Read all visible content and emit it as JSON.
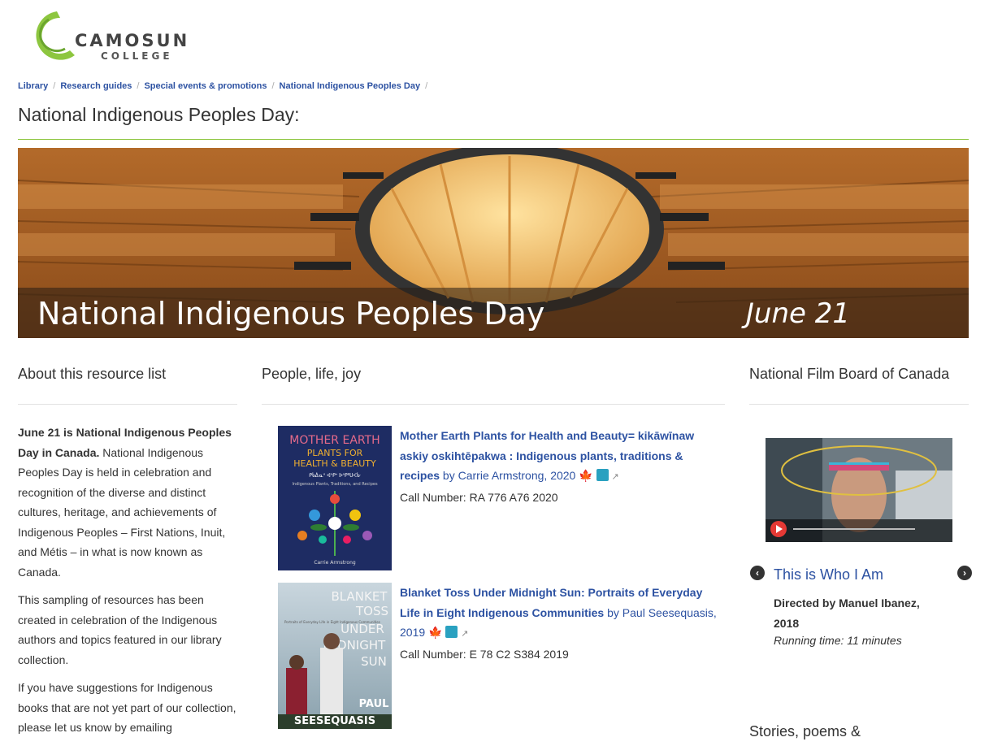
{
  "logo": {
    "line1": "CAMOSUN",
    "line2": "COLLEGE"
  },
  "breadcrumb": [
    "Library",
    "Research guides",
    "Special events & promotions",
    "National Indigenous Peoples Day"
  ],
  "page_title": "National Indigenous Peoples Day:",
  "banner": {
    "title": "National Indigenous Peoples Day",
    "date": "June 21"
  },
  "columns": {
    "about": {
      "heading": "About this resource list",
      "p1_bold": "June 21 is National Indigenous Peoples Day in Canada.",
      "p1_rest": " National Indigenous Peoples Day is held in celebration and recognition of the diverse and distinct cultures, heritage, and achievements of Indigenous Peoples – First Nations, Inuit, and Métis – in what is now known as Canada.",
      "p2": "This sampling of resources has been created in celebration of the Indigenous authors and topics featured in our library collection.",
      "p3": "If you have suggestions for Indigenous books that are not yet part of our collection, please let us know by emailing"
    },
    "people": {
      "heading": "People, life, joy",
      "books": [
        {
          "title": "Mother Earth Plants for Health and Beauty= kikāwīnaw askiy oskihtēpakwa : Indigenous plants, traditions & recipes",
          "by": " by Carrie Armstrong, 2020",
          "call_number": "Call Number: RA 776 A76 2020",
          "cover_lines": [
            "MOTHER EARTH",
            "PLANTS FOR",
            "HEALTH & BEAUTY",
            "ᑭᑳᐑᓇᐤ ᐊᐢᑭᐩ ᐅᐢᑭᐦᑌᐸᒁ",
            "Indigenous Plants, Traditions, and Recipes",
            "Carrie Armstrong"
          ]
        },
        {
          "title": "Blanket Toss Under Midnight Sun: Portraits of Everyday Life in Eight Indigenous Communities",
          "by": " by Paul Seesequasis, 2019",
          "call_number": "Call Number: E 78 C2 S384 2019",
          "cover_lines": [
            "BLANKET",
            "TOSS",
            "UNDER",
            "MIDNIGHT",
            "SUN",
            "PAUL",
            "SEESEQUASIS",
            "Portraits of Everyday Life in Eight Indigenous Communities"
          ]
        }
      ]
    },
    "nfb": {
      "heading": "National Film Board of Canada",
      "film_title": "This is Who I Am",
      "directed": "Directed by Manuel Ibanez, 2018",
      "running_time": "Running time: 11 minutes"
    },
    "next_heading": "Stories, poems &"
  },
  "colors": {
    "link": "#2d52a2",
    "rule_green": "#8dc63f",
    "logo_green": "#8dc63f"
  },
  "icons": {
    "prev": "chevron-left-circle-icon",
    "next": "chevron-right-circle-icon",
    "flag": "maple-leaf-icon",
    "external": "external-link-icon"
  }
}
